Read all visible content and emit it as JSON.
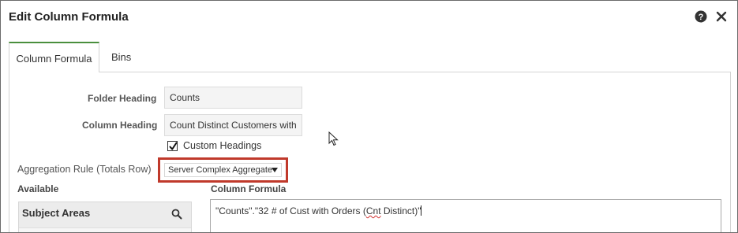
{
  "dialog": {
    "title": "Edit Column Formula",
    "help_icon": "help-circle-icon",
    "close_icon": "close-icon"
  },
  "tabs": [
    {
      "label": "Column Formula",
      "active": true
    },
    {
      "label": "Bins",
      "active": false
    }
  ],
  "form": {
    "folder_heading_label": "Folder Heading",
    "folder_heading_value": "Counts",
    "column_heading_label": "Column Heading",
    "column_heading_value": "Count Distinct Customers with",
    "custom_headings_label": "Custom Headings",
    "custom_headings_checked": true,
    "aggregation_rule_label": "Aggregation Rule (Totals Row)",
    "aggregation_rule_value": "Server Complex Aggregate"
  },
  "available": {
    "label": "Available",
    "subject_areas_title": "Subject Areas",
    "search_icon": "search-icon"
  },
  "formula": {
    "label": "Column Formula",
    "text_prefix": "\"Counts\".\"32 # of Cust with Orders (",
    "text_misspelled": "Cnt",
    "text_suffix": " Distinct)\""
  },
  "colors": {
    "active_tab_accent": "#4a8f3d",
    "highlight_border": "#c0392b"
  }
}
